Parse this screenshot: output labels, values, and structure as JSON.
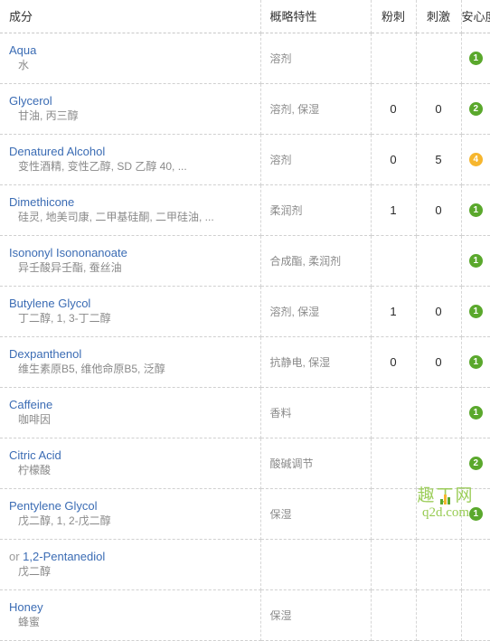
{
  "table": {
    "columns": [
      {
        "key": "name",
        "label": "成分",
        "align": "left"
      },
      {
        "key": "props",
        "label": "概略特性",
        "align": "left"
      },
      {
        "key": "acne",
        "label": "粉刺",
        "align": "center"
      },
      {
        "key": "irritant",
        "label": "刺激",
        "align": "center"
      },
      {
        "key": "safety",
        "label": "安心度",
        "align": "center"
      }
    ],
    "rows": [
      {
        "name_en": "Aqua",
        "name_or_prefix": "",
        "name_zh": "水",
        "props": "溶剂",
        "acne": "",
        "irritant": "",
        "safety": "1",
        "safety_level": "lvl1"
      },
      {
        "name_en": "Glycerol",
        "name_or_prefix": "",
        "name_zh": "甘油, 丙三醇",
        "props": "溶剂, 保湿",
        "acne": "0",
        "irritant": "0",
        "safety": "2",
        "safety_level": "lvl2"
      },
      {
        "name_en": "Denatured Alcohol",
        "name_or_prefix": "",
        "name_zh": "变性酒精, 变性乙醇, SD 乙醇 40, ...",
        "props": "溶剂",
        "acne": "0",
        "irritant": "5",
        "safety": "4",
        "safety_level": "lvl4"
      },
      {
        "name_en": "Dimethicone",
        "name_or_prefix": "",
        "name_zh": "硅灵, 地美司康, 二甲基硅酮, 二甲硅油, ...",
        "props": "柔润剂",
        "acne": "1",
        "irritant": "0",
        "safety": "1",
        "safety_level": "lvl1"
      },
      {
        "name_en": "Isononyl Isononanoate",
        "name_or_prefix": "",
        "name_zh": "异壬酸异壬酯, 蚕丝油",
        "props": "合成酯, 柔润剂",
        "acne": "",
        "irritant": "",
        "safety": "1",
        "safety_level": "lvl1"
      },
      {
        "name_en": "Butylene Glycol",
        "name_or_prefix": "",
        "name_zh": "丁二醇, 1, 3-丁二醇",
        "props": "溶剂, 保湿",
        "acne": "1",
        "irritant": "0",
        "safety": "1",
        "safety_level": "lvl1"
      },
      {
        "name_en": "Dexpanthenol",
        "name_or_prefix": "",
        "name_zh": "维生素原B5, 维他命原B5, 泛醇",
        "props": "抗静电, 保湿",
        "acne": "0",
        "irritant": "0",
        "safety": "1",
        "safety_level": "lvl1"
      },
      {
        "name_en": "Caffeine",
        "name_or_prefix": "",
        "name_zh": "咖啡因",
        "props": "香料",
        "acne": "",
        "irritant": "",
        "safety": "1",
        "safety_level": "lvl1"
      },
      {
        "name_en": "Citric Acid",
        "name_or_prefix": "",
        "name_zh": "柠檬酸",
        "props": "酸碱调节",
        "acne": "",
        "irritant": "",
        "safety": "2",
        "safety_level": "lvl2"
      },
      {
        "name_en": "Pentylene Glycol",
        "name_or_prefix": "",
        "name_zh": "戊二醇, 1, 2-戊二醇",
        "props": "保湿",
        "acne": "",
        "irritant": "",
        "safety": "1",
        "safety_level": "lvl1"
      },
      {
        "name_en": "1,2-Pentanediol",
        "name_or_prefix": "or ",
        "name_zh": "戊二醇",
        "props": "",
        "acne": "",
        "irritant": "",
        "safety": "",
        "safety_level": ""
      },
      {
        "name_en": "Honey",
        "name_or_prefix": "",
        "name_zh": "蜂蜜",
        "props": "保湿",
        "acne": "",
        "irritant": "",
        "safety": "",
        "safety_level": ""
      }
    ]
  },
  "watermark": {
    "cn": "趣丁网",
    "url": "q2d.com"
  },
  "colors": {
    "link": "#3b6cb4",
    "muted": "#8a8a8a",
    "safe_green": "#5aa82c",
    "warn_orange": "#f6b62e"
  }
}
